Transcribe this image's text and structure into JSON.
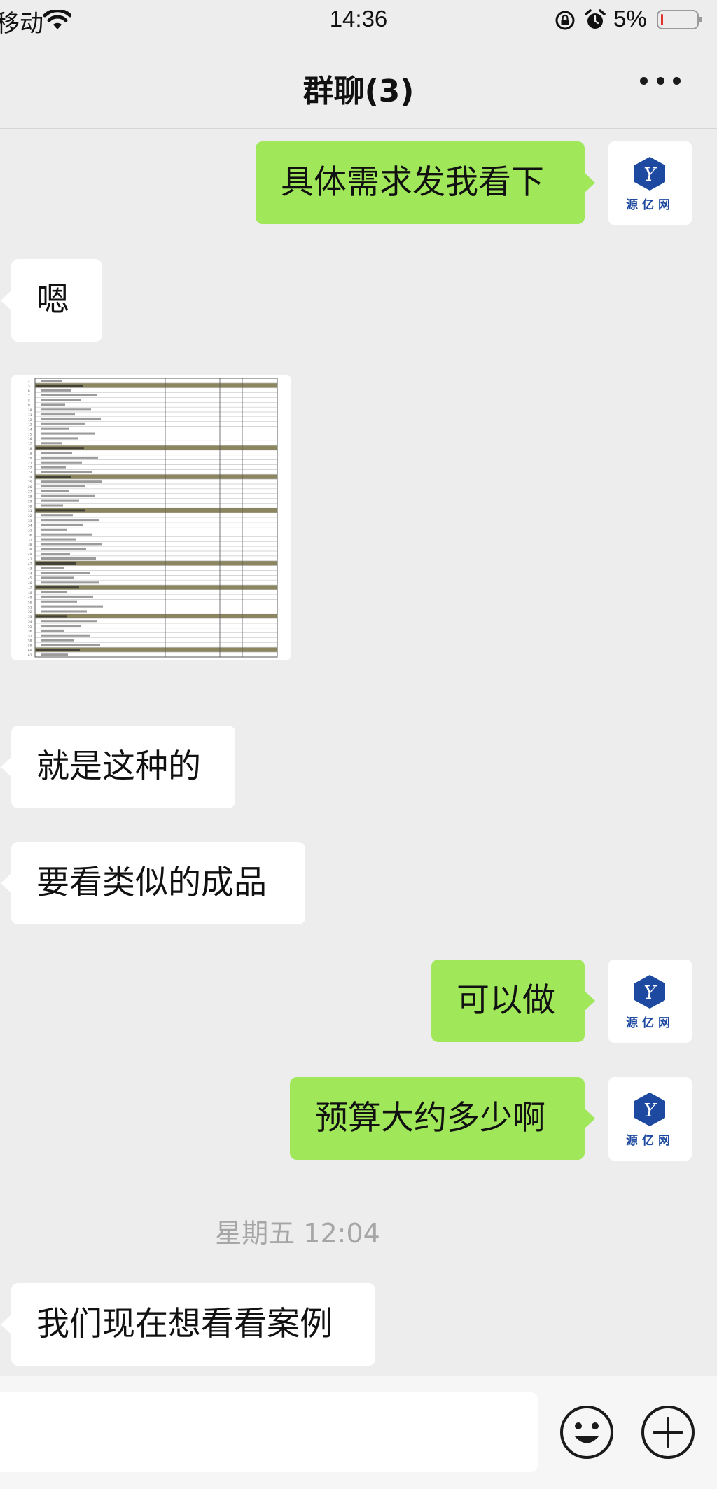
{
  "status_bar": {
    "carrier": "移动",
    "time": "14:36",
    "battery_percent": "5%",
    "battery_level": 0.05,
    "battery_color": "#e0352b",
    "icons": [
      "wifi-icon",
      "orientation-lock-icon",
      "alarm-icon",
      "battery-icon"
    ]
  },
  "header": {
    "title": "群聊(3)",
    "more_icon": "more-dots-icon"
  },
  "avatar": {
    "brand_text": "源亿网",
    "logo_letter": "Y",
    "logo_color": "#1d4aa0"
  },
  "messages": [
    {
      "side": "right",
      "text": "具体需求发我看下"
    },
    {
      "side": "left",
      "text": "嗯"
    },
    {
      "side": "left",
      "type": "image",
      "description": "spreadsheet-screenshot"
    },
    {
      "side": "left",
      "text": "就是这种的"
    },
    {
      "side": "left",
      "text": "要看类似的成品"
    },
    {
      "side": "right",
      "text": "可以做"
    },
    {
      "side": "right",
      "text": "预算大约多少啊"
    },
    {
      "type": "timestamp",
      "text": "星期五 12:04"
    },
    {
      "side": "left",
      "text": "我们现在想看看案例"
    }
  ],
  "input_bar": {
    "placeholder": "",
    "emoji_icon": "emoji-icon",
    "plus_icon": "plus-icon"
  },
  "colors": {
    "background": "#ededed",
    "sent_bubble": "#a0e75a",
    "received_bubble": "#ffffff",
    "timestamp_text": "#a6a6a6"
  }
}
